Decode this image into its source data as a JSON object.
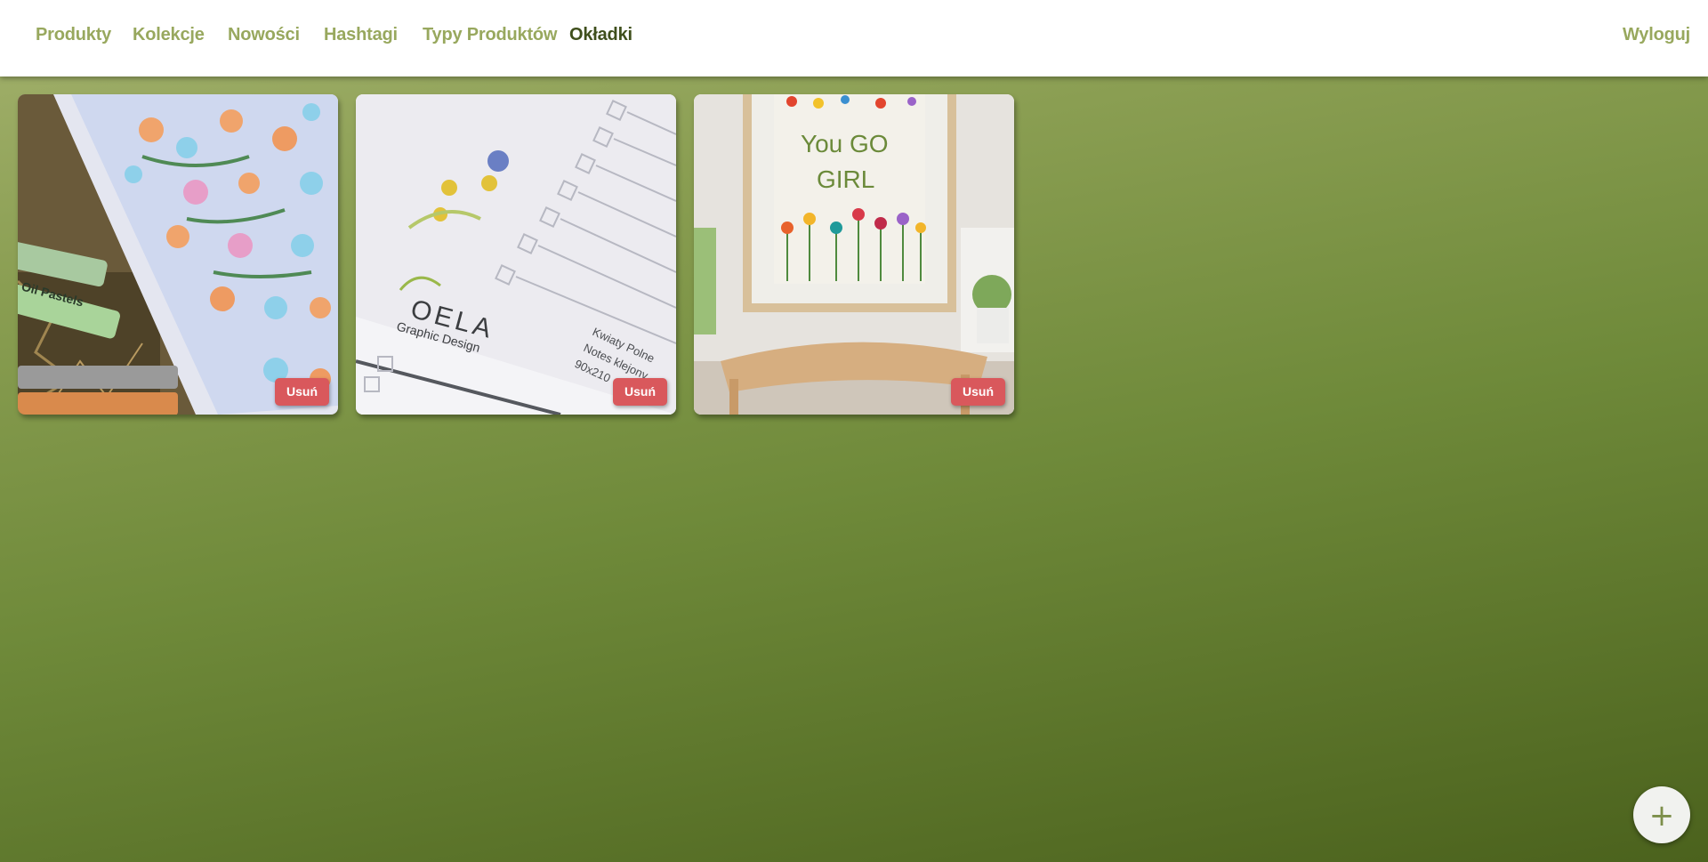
{
  "nav": {
    "items": [
      {
        "label": "Produkty"
      },
      {
        "label": "Kolekcje"
      },
      {
        "label": "Nowości"
      },
      {
        "label": "Hashtagi"
      },
      {
        "label": "Typy Produktów"
      },
      {
        "label": "Okładki",
        "active": true
      }
    ],
    "logout_label": "Wyloguj"
  },
  "covers": [
    {
      "image": "notebook-floral-cover-with-oil-pastels",
      "pastel_label": "Oil Pastels",
      "delete_label": "Usuń"
    },
    {
      "image": "notebook-page-checklist-with-logo",
      "logo_text": "OELA",
      "logo_subtitle": "Graphic Design",
      "note_lines": [
        "Kwiaty Polne",
        "Notes klejony",
        "90x210"
      ],
      "delete_label": "Usuń"
    },
    {
      "image": "framed-poster-you-go-girl",
      "poster_lines": [
        "You GO",
        "GIRL"
      ],
      "delete_label": "Usuń"
    }
  ],
  "fab": {
    "icon": "plus-icon",
    "symbol": "+"
  },
  "colors": {
    "accent": "#98a85e",
    "active": "#3f4f1c",
    "danger": "#d9585c"
  }
}
